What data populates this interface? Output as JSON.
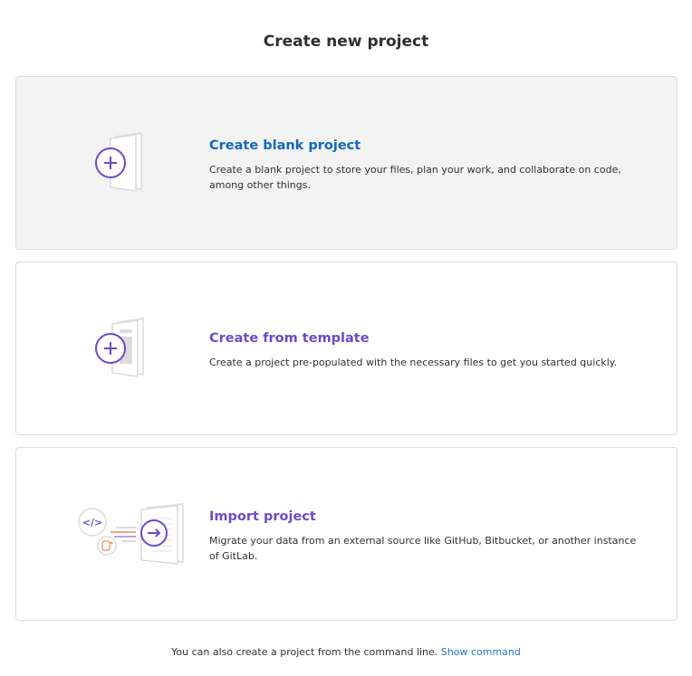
{
  "page": {
    "title": "Create new project"
  },
  "cards": [
    {
      "title": "Create blank project",
      "description": "Create a blank project to store your files, plan your work, and collaborate on code, among other things.",
      "title_color": "#1068bf"
    },
    {
      "title": "Create from template",
      "description": "Create a project pre-populated with the necessary files to get you started quickly.",
      "title_color": "#6e49cb"
    },
    {
      "title": "Import project",
      "description": "Migrate your data from an external source like GitHub, Bitbucket, or another instance of GitLab.",
      "title_color": "#6e49cb"
    }
  ],
  "footer": {
    "text": "You can also create a project from the command line.",
    "link": "Show command"
  },
  "colors": {
    "accent_purple": "#6e49cb",
    "link_blue": "#1f75cb",
    "hover_bg": "#f3f3f3"
  }
}
